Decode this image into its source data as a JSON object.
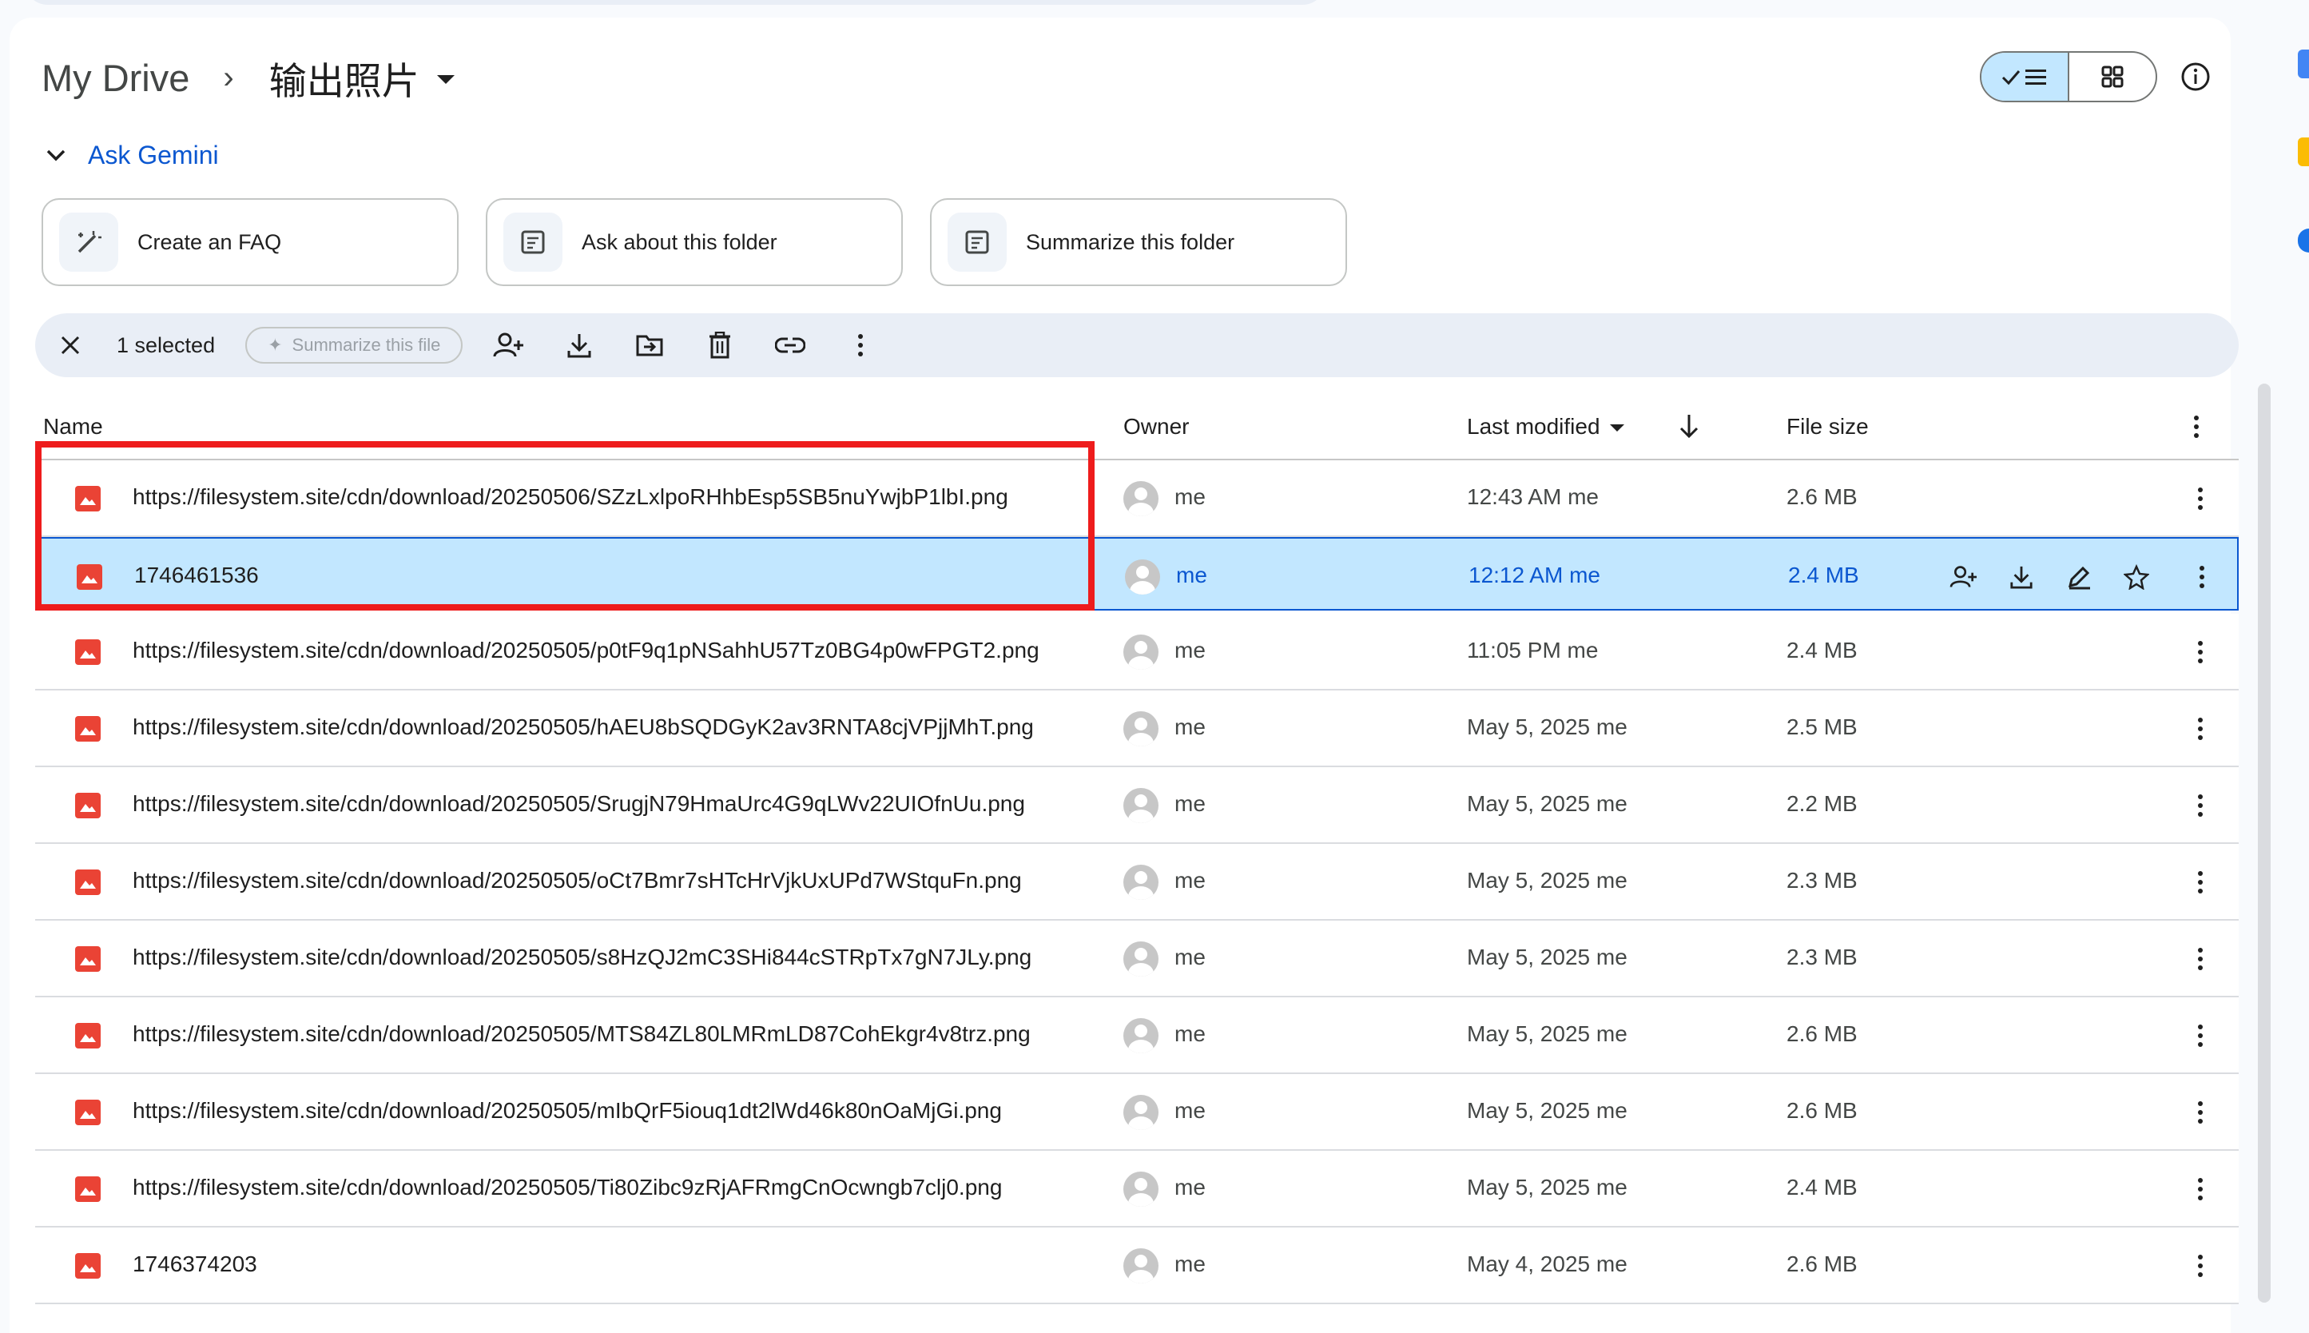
{
  "breadcrumb": {
    "root": "My Drive",
    "separator": "›",
    "current": "输出照片"
  },
  "gemini": {
    "label": "Ask Gemini"
  },
  "suggestions": [
    {
      "label": "Create an FAQ",
      "icon": "magic-pen-icon"
    },
    {
      "label": "Ask about this folder",
      "icon": "folder-question-icon"
    },
    {
      "label": "Summarize this folder",
      "icon": "folder-summary-icon"
    }
  ],
  "selection_bar": {
    "count": "1 selected",
    "summarize_label": "Summarize this file",
    "tools": [
      "share-icon",
      "download-icon",
      "move-icon",
      "trash-icon",
      "link-icon",
      "more-vert-icon"
    ]
  },
  "table": {
    "headers": {
      "name": "Name",
      "owner": "Owner",
      "modified": "Last modified",
      "size": "File size"
    },
    "rows": [
      {
        "name": "https://filesystem.site/cdn/download/20250506/SZzLxlpoRHhbEsp5SB5nuYwjbP1lbI.png",
        "owner": "me",
        "modified": "12:43 AM  me",
        "size": "2.6 MB",
        "selected": false
      },
      {
        "name": "1746461536",
        "owner": "me",
        "modified": "12:12 AM  me",
        "size": "2.4 MB",
        "selected": true
      },
      {
        "name": "https://filesystem.site/cdn/download/20250505/p0tF9q1pNSahhU57Tz0BG4p0wFPGT2.png",
        "owner": "me",
        "modified": "11:05 PM  me",
        "size": "2.4 MB",
        "selected": false
      },
      {
        "name": "https://filesystem.site/cdn/download/20250505/hAEU8bSQDGyK2av3RNTA8cjVPjjMhT.png",
        "owner": "me",
        "modified": "May 5, 2025  me",
        "size": "2.5 MB",
        "selected": false
      },
      {
        "name": "https://filesystem.site/cdn/download/20250505/SrugjN79HmaUrc4G9qLWv22UIOfnUu.png",
        "owner": "me",
        "modified": "May 5, 2025  me",
        "size": "2.2 MB",
        "selected": false
      },
      {
        "name": "https://filesystem.site/cdn/download/20250505/oCt7Bmr7sHTcHrVjkUxUPd7WStquFn.png",
        "owner": "me",
        "modified": "May 5, 2025  me",
        "size": "2.3 MB",
        "selected": false
      },
      {
        "name": "https://filesystem.site/cdn/download/20250505/s8HzQJ2mC3SHi844cSTRpTx7gN7JLy.png",
        "owner": "me",
        "modified": "May 5, 2025  me",
        "size": "2.3 MB",
        "selected": false
      },
      {
        "name": "https://filesystem.site/cdn/download/20250505/MTS84ZL80LMRmLD87CohEkgr4v8trz.png",
        "owner": "me",
        "modified": "May 5, 2025  me",
        "size": "2.6 MB",
        "selected": false
      },
      {
        "name": "https://filesystem.site/cdn/download/20250505/mIbQrF5iouq1dt2lWd46k80nOaMjGi.png",
        "owner": "me",
        "modified": "May 5, 2025  me",
        "size": "2.6 MB",
        "selected": false
      },
      {
        "name": "https://filesystem.site/cdn/download/20250505/Ti80Zibc9zRjAFRmgCnOcwngb7clj0.png",
        "owner": "me",
        "modified": "May 5, 2025  me",
        "size": "2.4 MB",
        "selected": false
      },
      {
        "name": "1746374203",
        "owner": "me",
        "modified": "May 4, 2025  me",
        "size": "2.6 MB",
        "selected": false
      }
    ]
  },
  "colors": {
    "accent": "#0b57d0",
    "selected_row": "#c2e7ff",
    "file_icon": "#ea4335",
    "highlight_box": "#ee1c1c"
  }
}
